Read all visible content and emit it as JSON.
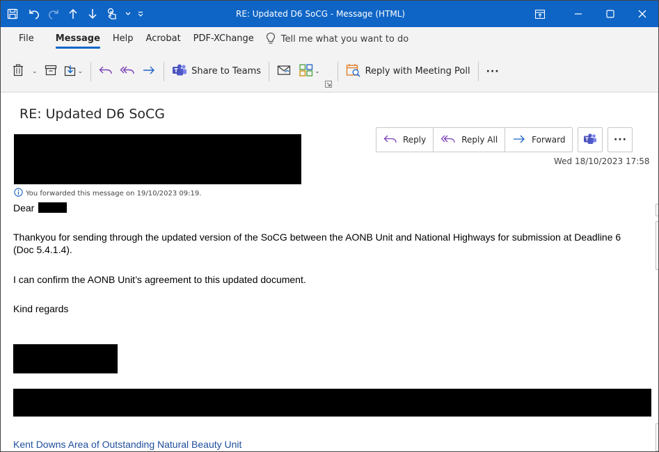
{
  "titlebar": {
    "title": "RE: Updated D6 SoCG  -  Message (HTML)",
    "accent": "#0f65c6",
    "icons": [
      "save-icon",
      "undo-icon",
      "redo-icon",
      "up-arrow-icon",
      "down-arrow-icon",
      "touch-mode-icon",
      "qat-caret-icon",
      "customize-qat-icon"
    ],
    "window_controls": [
      "ribbon-display-icon",
      "minimize-icon",
      "maximize-icon",
      "close-icon"
    ]
  },
  "menu": {
    "tabs": [
      "File",
      "Message",
      "Help",
      "Acrobat",
      "PDF-XChange"
    ],
    "active": "Message",
    "tell_me": "Tell me what you want to do"
  },
  "ribbon": {
    "share_to_teams": "Share to Teams",
    "reply_with_meeting_poll": "Reply with Meeting Poll",
    "more": "···"
  },
  "message": {
    "subject": "RE: Updated D6 SoCG",
    "actions": {
      "reply": "Reply",
      "reply_all": "Reply All",
      "forward": "Forward",
      "more": "···"
    },
    "datetime": "Wed 18/10/2023 17:58",
    "info": "You forwarded this message on 19/10/2023 09:19.",
    "body": {
      "greeting": "Dear",
      "para1": "Thankyou for sending through the updated version of the SoCG between the AONB Unit and National Highways for submission at Deadline 6 (Doc 5.4.1.4).",
      "para2": "I can confirm the AONB Unit’s agreement to this updated document.",
      "signoff": "Kind regards",
      "signature_org": "Kent Downs Area of Outstanding Natural Beauty Unit"
    }
  }
}
